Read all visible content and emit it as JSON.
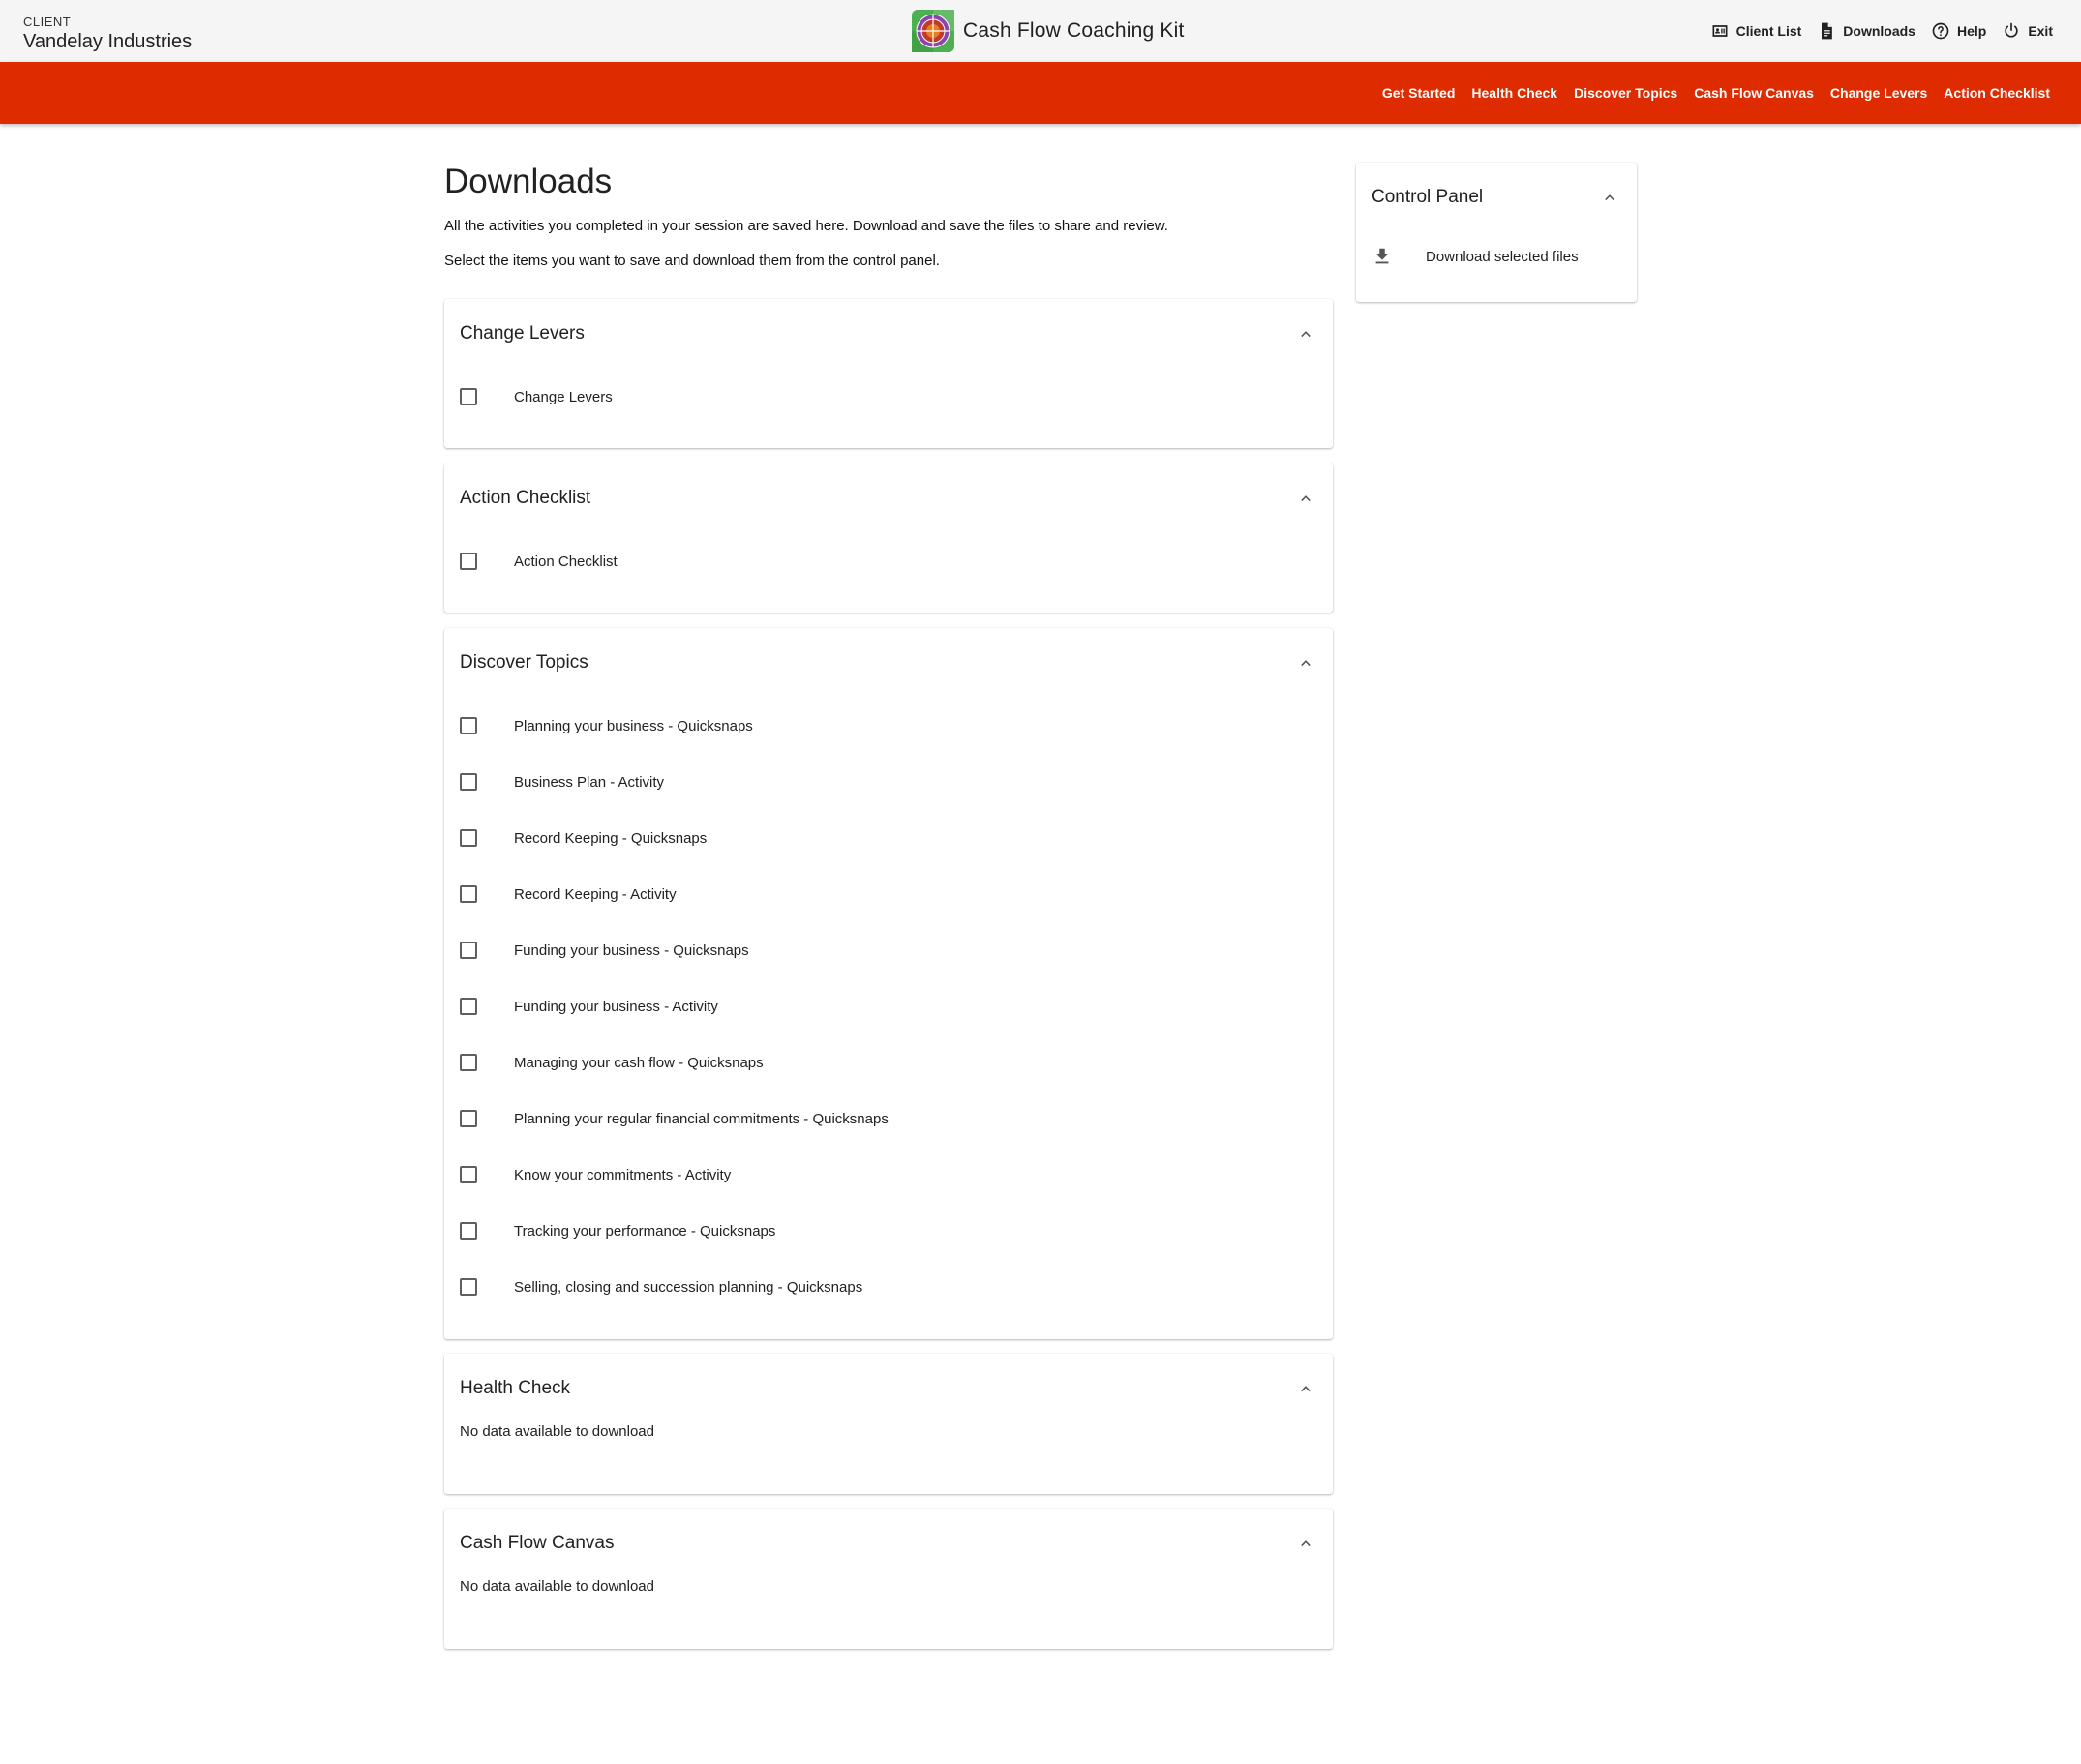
{
  "client": {
    "label": "CLIENT",
    "name": "Vandelay Industries"
  },
  "app": {
    "title": "Cash Flow Coaching Kit",
    "logo_icon": "wheel-logo-icon"
  },
  "topnav": [
    {
      "label": "Client List",
      "icon": "contact-card-icon"
    },
    {
      "label": "Downloads",
      "icon": "document-icon"
    },
    {
      "label": "Help",
      "icon": "help-circle-icon"
    },
    {
      "label": "Exit",
      "icon": "power-icon"
    }
  ],
  "rednav": [
    "Get Started",
    "Health Check",
    "Discover Topics",
    "Cash Flow Canvas",
    "Change Levers",
    "Action Checklist"
  ],
  "colors": {
    "accent": "#de2b00",
    "topbar_bg": "#f5f5f5"
  },
  "page": {
    "title": "Downloads",
    "intro": "All the activities you completed in your session are saved here. Download and save the files to share and review.",
    "intro2": "Select the items you want to save and download them from the control panel."
  },
  "sections": [
    {
      "title": "Change Levers",
      "items": [
        "Change Levers"
      ]
    },
    {
      "title": "Action Checklist",
      "items": [
        "Action Checklist"
      ]
    },
    {
      "title": "Discover Topics",
      "items": [
        "Planning your business - Quicksnaps",
        "Business Plan - Activity",
        "Record Keeping - Quicksnaps",
        "Record Keeping - Activity",
        "Funding your business - Quicksnaps",
        "Funding your business - Activity",
        "Managing your cash flow - Quicksnaps",
        "Planning your regular financial commitments - Quicksnaps",
        "Know your commitments - Activity",
        "Tracking your performance - Quicksnaps",
        "Selling, closing and succession planning - Quicksnaps"
      ]
    },
    {
      "title": "Health Check",
      "empty_text": "No data available to download"
    },
    {
      "title": "Cash Flow Canvas",
      "empty_text": "No data available to download"
    }
  ],
  "control_panel": {
    "title": "Control Panel",
    "action_label": "Download selected files",
    "action_icon": "download-icon"
  }
}
